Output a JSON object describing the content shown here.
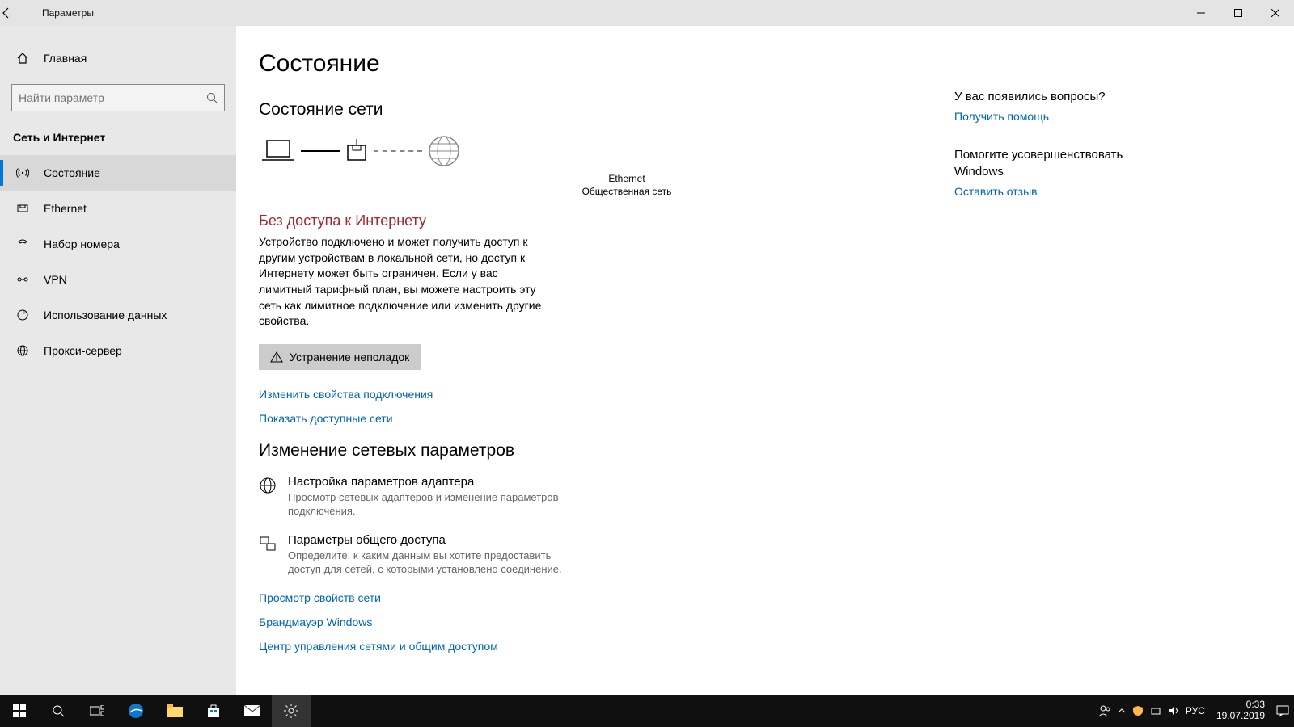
{
  "titlebar": {
    "title": "Параметры"
  },
  "sidebar": {
    "home": "Главная",
    "search_placeholder": "Найти параметр",
    "category": "Сеть и Интернет",
    "items": [
      {
        "label": "Состояние",
        "icon": "status-icon",
        "active": true
      },
      {
        "label": "Ethernet",
        "icon": "ethernet-icon",
        "active": false
      },
      {
        "label": "Набор номера",
        "icon": "dialup-icon",
        "active": false
      },
      {
        "label": "VPN",
        "icon": "vpn-icon",
        "active": false
      },
      {
        "label": "Использование данных",
        "icon": "datausage-icon",
        "active": false
      },
      {
        "label": "Прокси-сервер",
        "icon": "proxy-icon",
        "active": false
      }
    ]
  },
  "main": {
    "page_title": "Состояние",
    "section1_title": "Состояние сети",
    "net": {
      "adapter": "Ethernet",
      "profile": "Общественная сеть"
    },
    "status_heading": "Без доступа к Интернету",
    "status_desc": "Устройство подключено и может получить доступ к другим устройствам в локальной сети, но доступ к Интернету может быть ограничен. Если у вас лимитный тарифный план, вы можете настроить эту сеть как лимитное подключение или изменить другие свойства.",
    "troubleshoot_label": "Устранение неполадок",
    "link_change_props": "Изменить свойства подключения",
    "link_show_networks": "Показать доступные сети",
    "section2_title": "Изменение сетевых параметров",
    "adapter_options": {
      "title": "Настройка параметров адаптера",
      "sub": "Просмотр сетевых адаптеров и изменение параметров подключения."
    },
    "sharing_options": {
      "title": "Параметры общего доступа",
      "sub": "Определите, к каким данным вы хотите предоставить доступ для сетей, с которыми установлено соединение."
    },
    "link_view_props": "Просмотр свойств сети",
    "link_firewall": "Брандмауэр Windows",
    "link_sharing_center": "Центр управления сетями и общим доступом"
  },
  "aside": {
    "q_head": "У вас появились вопросы?",
    "q_link": "Получить помощь",
    "f_head": "Помогите усовершенствовать Windows",
    "f_link": "Оставить отзыв"
  },
  "taskbar": {
    "lang": "РУС",
    "time": "0:33",
    "date": "19.07.2019"
  }
}
